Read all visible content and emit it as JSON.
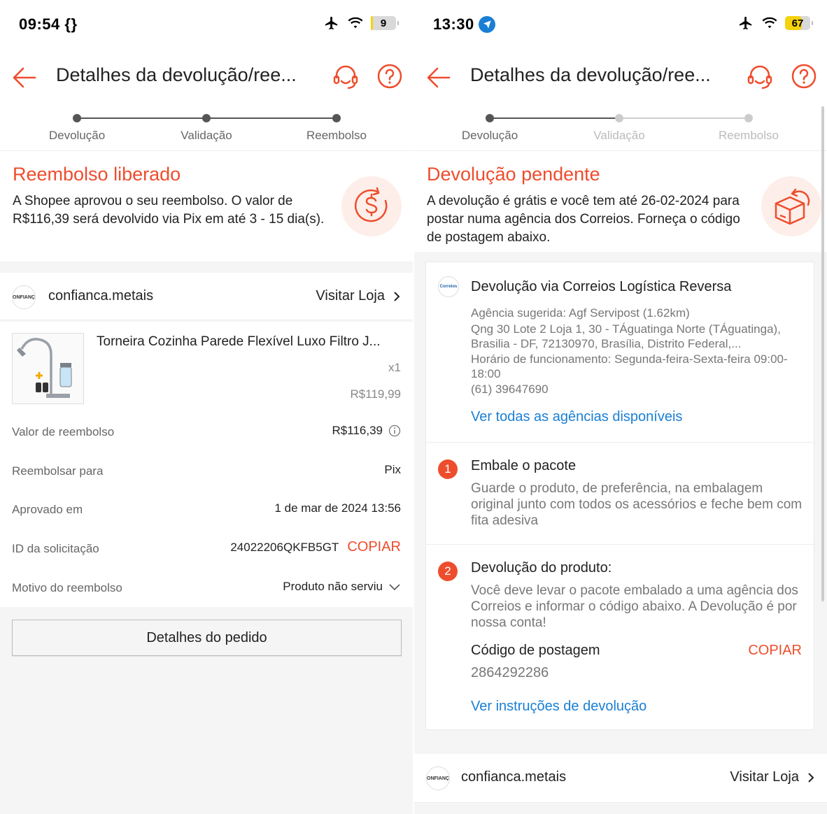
{
  "left": {
    "status": {
      "time": "09:54 {}",
      "battery": "9",
      "battery_level": 0.09
    },
    "nav": {
      "title": "Detalhes da devolução/ree..."
    },
    "steps": [
      {
        "label": "Devolução",
        "active": true
      },
      {
        "label": "Validação",
        "active": true
      },
      {
        "label": "Reembolso",
        "active": true
      }
    ],
    "status_title": "Reembolso liberado",
    "status_desc": "A Shopee aprovou o seu reembolso. O valor de R$116,39 será devolvido via Pix em até 3 - 15 dia(s).",
    "shop": {
      "avatar": "CONFIANÇA",
      "name": "confianca.metais",
      "visit": "Visitar Loja"
    },
    "product": {
      "name": "Torneira Cozinha Parede Flexível Luxo Filtro J...",
      "qty": "x1",
      "price": "R$119,99"
    },
    "details": [
      {
        "label": "Valor de reembolso",
        "value": "R$116,39"
      },
      {
        "label": "Reembolsar para",
        "value": "Pix"
      },
      {
        "label": "Aprovado em",
        "value": "1 de mar de 2024 13:56"
      },
      {
        "label": "ID da solicitação",
        "value": "24022206QKFB5GT",
        "action": "COPIAR"
      },
      {
        "label": "Motivo do reembolso",
        "value": "Produto não serviu"
      }
    ],
    "order_button": "Detalhes do pedido"
  },
  "right": {
    "status": {
      "time": "13:30",
      "battery": "67",
      "battery_level": 0.67
    },
    "nav": {
      "title": "Detalhes da devolução/ree..."
    },
    "steps": [
      {
        "label": "Devolução",
        "active": true
      },
      {
        "label": "Validação",
        "active": false
      },
      {
        "label": "Reembolso",
        "active": false
      }
    ],
    "status_title": "Devolução pendente",
    "status_desc": "A devolução é grátis e você tem até 26-02-2024 para postar numa agência dos Correios. Forneça o código de postagem abaixo.",
    "correios": {
      "logo": "Correios",
      "title": "Devolução via Correios Logística Reversa",
      "agency": "Agência sugerida: Agf Servipost (1.62km)",
      "address": "Qng 30 Lote 2 Loja 1, 30 - TÁguatinga Norte (TÁguatinga), Brasilia - DF, 72130970, Brasília, Distrito Federal,...",
      "hours": "Horário de funcionamento: Segunda-feira-Sexta-feira 09:00-18:00",
      "phone": "(61) 39647690",
      "link": "Ver todas as agências disponíveis"
    },
    "step1": {
      "num": "1",
      "title": "Embale o pacote",
      "body": "Guarde o produto, de preferência, na embalagem original junto com todos os acessórios e feche bem com fita adesiva"
    },
    "step2": {
      "num": "2",
      "title": "Devolução do produto:",
      "body": "Você deve levar o pacote embalado a uma agência dos Correios e informar o código abaixo. A Devolução é por nossa conta!",
      "code_label": "Código de postagem",
      "code_action": "COPIAR",
      "code": "2864292286",
      "link": "Ver instruções de devolução"
    },
    "shop": {
      "avatar": "CONFIANÇA",
      "name": "confianca.metais",
      "visit": "Visitar Loja"
    }
  },
  "colors": {
    "accent": "#ee4d2d",
    "link": "#1a7fd4",
    "battery": "#f5d20e"
  }
}
